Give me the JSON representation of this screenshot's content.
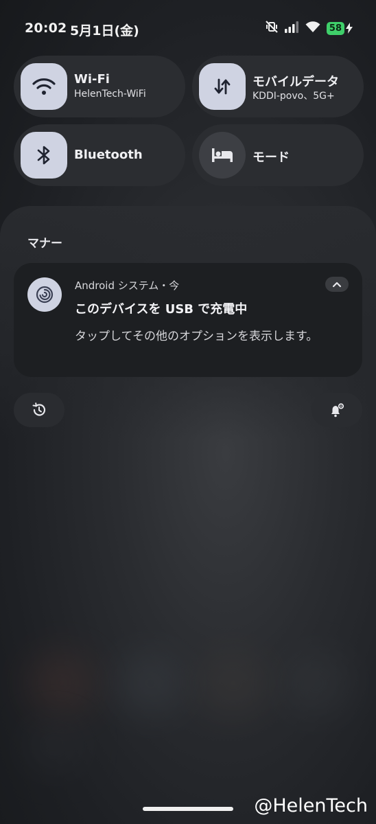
{
  "status_bar": {
    "time": "20:02",
    "date": "5月1日(金)",
    "battery_level": "58",
    "icons": [
      "vibrate-off-icon",
      "signal-icon",
      "wifi-icon",
      "battery-icon",
      "charging-bolt-icon"
    ]
  },
  "quick_tiles": [
    {
      "title": "Wi-Fi",
      "subtitle": "HelenTech-WiFi",
      "icon": "wifi-icon",
      "active": true
    },
    {
      "title": "モバイルデータ",
      "subtitle": "KDDI-povo、5G+",
      "icon": "mobile-data-icon",
      "active": true
    },
    {
      "title": "Bluetooth",
      "subtitle": "",
      "icon": "bluetooth-icon",
      "active": true
    },
    {
      "title": "モード",
      "subtitle": "",
      "icon": "bed-icon",
      "active": false
    }
  ],
  "notifications": {
    "section_title": "マナー",
    "items": [
      {
        "app_header": "Android システム・今",
        "title": "このデバイスを USB で充電中",
        "body": "タップしてその他のオプションを表示します。",
        "icon": "android-system-swirl-icon"
      }
    ]
  },
  "controls": {
    "history_icon": "history-icon",
    "settings_icon": "notification-settings-icon"
  },
  "watermark": "@HelenTech",
  "colors": {
    "tile_active": "#cfd3e2",
    "tile_bg": "#2b2d31",
    "card_bg": "#1d1f22",
    "battery": "#3fcf6a"
  }
}
